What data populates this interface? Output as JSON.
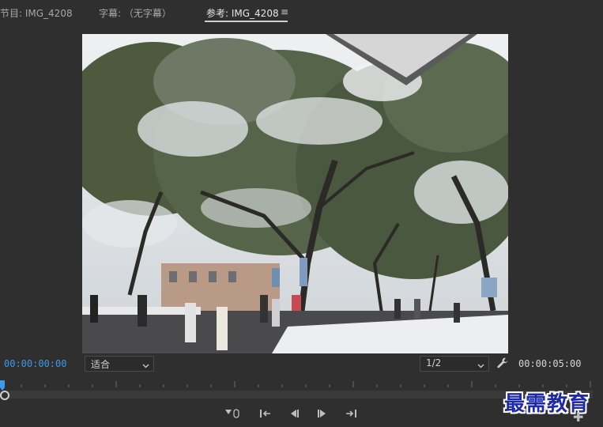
{
  "tabs": [
    {
      "label": "节目: IMG_4208"
    },
    {
      "label": "字幕: （无字幕）"
    },
    {
      "label": "参考: IMG_4208"
    }
  ],
  "viewer": {
    "current_time": "00:00:00:00",
    "fit_select": "适合",
    "resolution_select": "1/2",
    "duration": "00:00:05:00"
  },
  "icons": {
    "tab_menu": "hamburger-menu-icon",
    "settings": "wrench-icon",
    "transport": [
      "add-marker-icon",
      "step-to-in-icon",
      "step-back-icon",
      "step-forward-icon",
      "step-to-out-icon"
    ],
    "add": "plus-icon"
  },
  "watermark": {
    "text": "最需教育"
  },
  "colors": {
    "timecode_accent": "#3d9ae8",
    "panel_bg": "#2f2f2f",
    "watermark": "#1f2aa8"
  }
}
